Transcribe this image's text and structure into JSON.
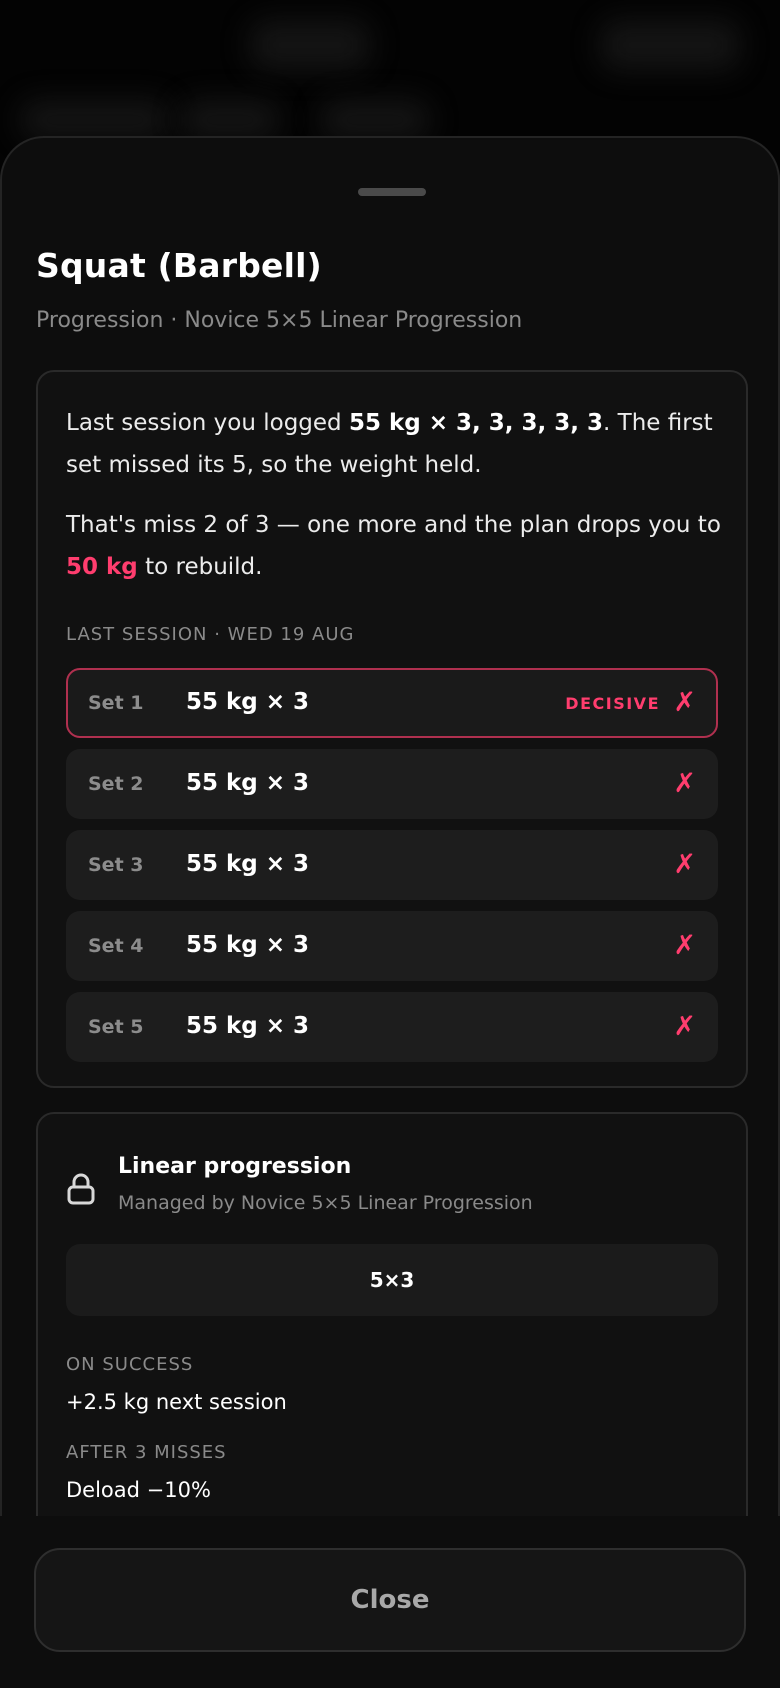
{
  "sheet": {
    "title": "Squat (Barbell)",
    "subtitle": "Progression · Novice 5×5 Linear Progression"
  },
  "summary": {
    "p1_before": "Last session you logged ",
    "p1_bold": "55 kg × 3, 3, 3, 3, 3",
    "p1_after": ". The first set missed its 5, so the weight held.",
    "p2_before": "That's miss 2 of 3 — one more and the plan drops you to ",
    "p2_accent": "50 kg",
    "p2_after": " to rebuild."
  },
  "last_session": {
    "label": "LAST SESSION · WED 19 AUG",
    "sets": [
      {
        "num": "Set 1",
        "value": "55 kg × 3",
        "badge": "DECISIVE",
        "status": "✗",
        "decisive": true
      },
      {
        "num": "Set 2",
        "value": "55 kg × 3",
        "badge": "",
        "status": "✗",
        "decisive": false
      },
      {
        "num": "Set 3",
        "value": "55 kg × 3",
        "badge": "",
        "status": "✗",
        "decisive": false
      },
      {
        "num": "Set 4",
        "value": "55 kg × 3",
        "badge": "",
        "status": "✗",
        "decisive": false
      },
      {
        "num": "Set 5",
        "value": "55 kg × 3",
        "badge": "",
        "status": "✗",
        "decisive": false
      }
    ]
  },
  "progression": {
    "icon": "lock-icon",
    "title": "Linear progression",
    "subtitle": "Managed by Novice 5×5 Linear Progression",
    "scheme": "5×3",
    "on_success_label": "ON SUCCESS",
    "on_success_value": "+2.5 kg next session",
    "after_misses_label": "AFTER 3 MISSES",
    "after_misses_value": "Deload −10%"
  },
  "footer": {
    "close_label": "Close"
  },
  "colors": {
    "accent": "#ff3d6e",
    "background": "#0d0d0d",
    "card": "#111111",
    "row": "#1d1d1d"
  }
}
